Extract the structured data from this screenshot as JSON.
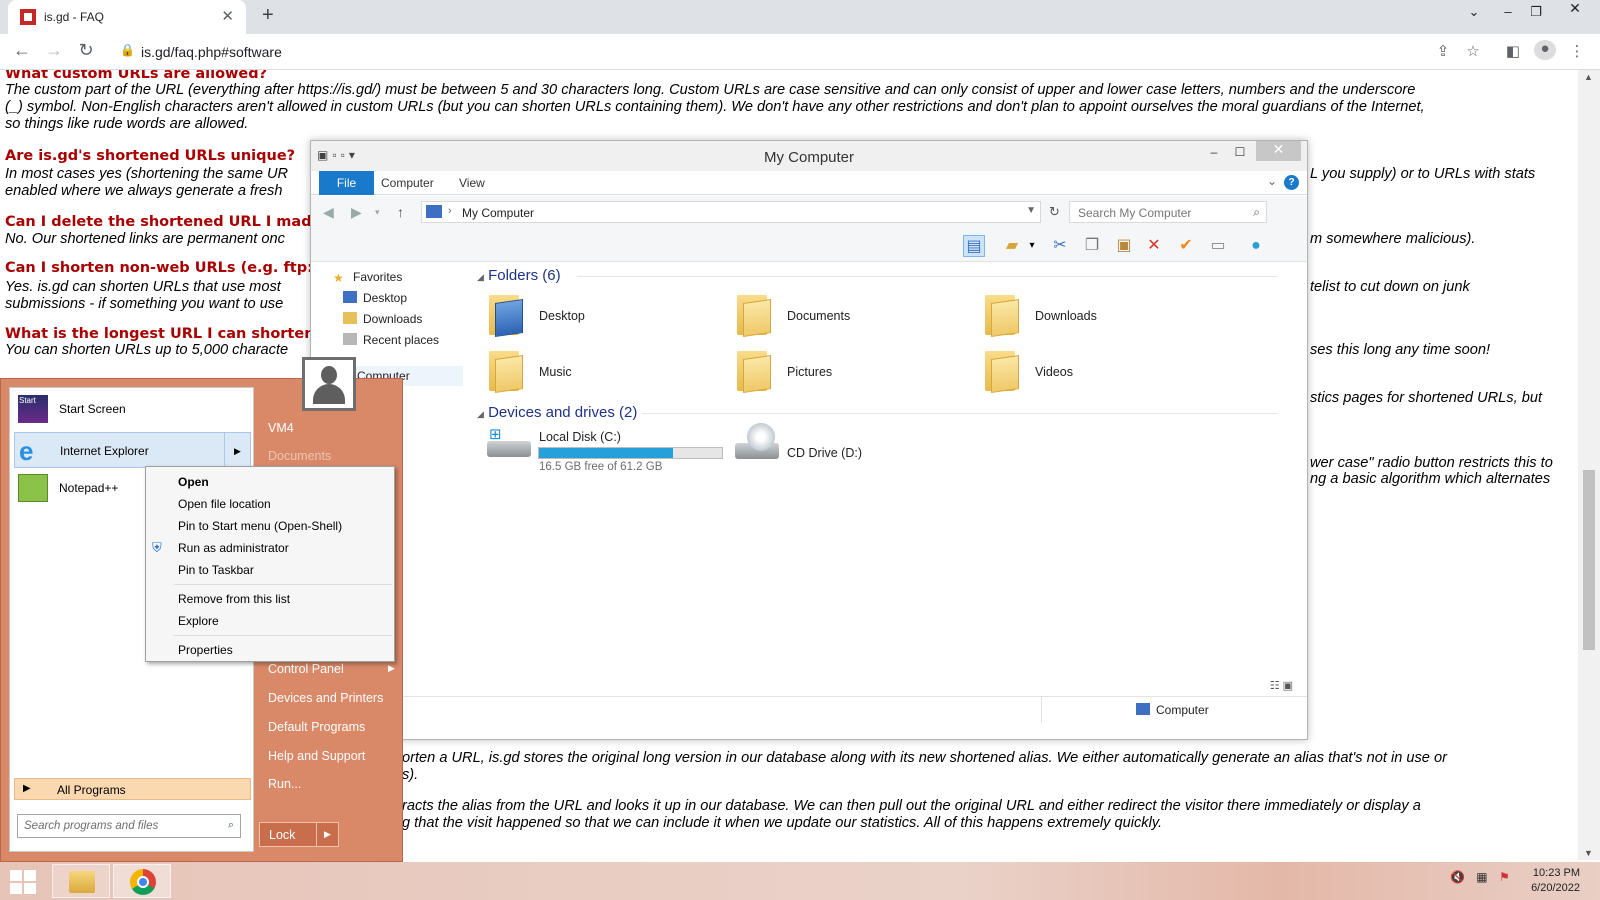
{
  "browser": {
    "tab_title": "is.gd - FAQ",
    "tab_close": "✕",
    "new_tab": "+",
    "url": "is.gd/faq.php#software",
    "window_controls": [
      "⌄",
      "–",
      "❐",
      "✕"
    ]
  },
  "page": {
    "q1": "What custom URLs are allowed?",
    "a1_l1": "The custom part of the URL (everything after https://is.gd/) must be between 5 and 30 characters long. Custom URLs are case sensitive and can only consist of upper and lower case letters, numbers and the underscore",
    "a1_l2": "(_) symbol. Non-English characters aren't allowed in custom URLs (but you can shorten URLs containing them). We don't have any other restrictions and don't plan to appoint ourselves the moral guardians of the Internet,",
    "a1_l3": "so things like rude words are allowed.",
    "q2": "Are is.gd's shortened URLs unique?",
    "a2_l1": "In most cases yes (shortening the same UR",
    "a2_r1": "L you supply) or to URLs with stats",
    "a2_l2": "enabled where we always generate a fresh",
    "q3": "Can I delete the shortened URL I made",
    "a3_l1": "No. Our shortened links are permanent onc",
    "a3_r1": "m somewhere malicious).",
    "q4": "Can I shorten non-web URLs (e.g. ftp:/",
    "a4_l1": "Yes. is.gd can shorten URLs that use most",
    "a4_r1": "telist to cut down on junk",
    "a4_l2": "submissions - if something you want to use",
    "q5": "What is the longest URL I can shorten",
    "a5_l1": "You can shorten URLs up to 5,000 characte",
    "a5_r1": "ses this long any time soon!",
    "r6": "stics pages for shortened URLs, but",
    "r7_l1": "wer case\" radio button restricts this to",
    "r7_l2": "ng a basic algorithm which alternates",
    "b1_l1": "orten a URL, is.gd stores the original long version in our database along with its new shortened alias. We either automatically generate an alias that's not in use or",
    "b1_l2": "s).",
    "b2_l1": "racts the alias from the URL and looks it up in our database. We can then pull out the original URL and either redirect the visitor there immediately or display a",
    "b2_l2": "g that the visit happened so that we can include it when we update our statistics. All of this happens extremely quickly."
  },
  "explorer": {
    "title": "My Computer",
    "ribbon_tabs": [
      "File",
      "Computer",
      "View"
    ],
    "address": "My Computer",
    "search_placeholder": "Search My Computer",
    "nav": {
      "favorites": "Favorites",
      "items": [
        "Desktop",
        "Downloads",
        "Recent places"
      ],
      "computer": "Computer"
    },
    "folders_header": "Folders (6)",
    "folders": [
      "Desktop",
      "Documents",
      "Downloads",
      "Music",
      "Pictures",
      "Videos"
    ],
    "drives_header": "Devices and drives (2)",
    "drives": [
      {
        "name": "Local Disk (C:)",
        "free": "16.5 GB free of 61.2 GB",
        "used_fraction": 0.73
      },
      {
        "name": "CD Drive (D:)"
      }
    ],
    "status_location": "Computer"
  },
  "start_menu": {
    "pinned": [
      "Start Screen",
      "Internet Explorer",
      "Notepad++"
    ],
    "start_tile_text": "Start",
    "all_programs": "All Programs",
    "search_placeholder": "Search programs and files",
    "right_items": [
      "VM4",
      "Documents",
      "Control Panel",
      "Devices and Printers",
      "Default Programs",
      "Help and Support",
      "Run..."
    ],
    "lock": "Lock"
  },
  "context_menu": {
    "items": [
      "Open",
      "Open file location",
      "Pin to Start menu (Open-Shell)",
      "Run as administrator",
      "Pin to Taskbar",
      "Remove from this list",
      "Explore",
      "Properties"
    ]
  },
  "taskbar": {
    "time": "10:23 PM",
    "date": "6/20/2022"
  }
}
